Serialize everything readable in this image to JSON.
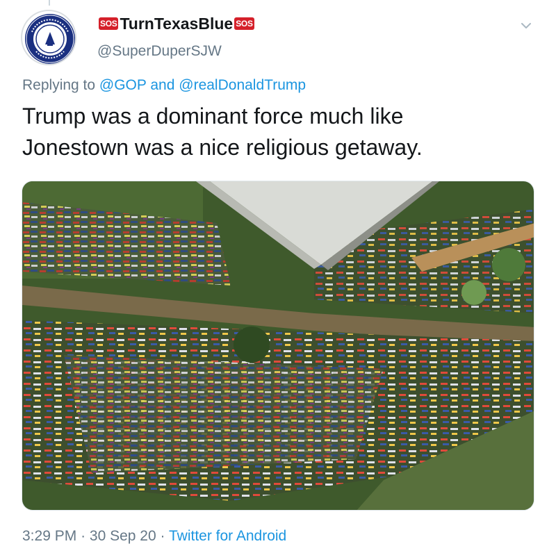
{
  "tweet": {
    "display_name": "TurnTexasBlue",
    "badge_left": "SOS",
    "badge_right": "SOS",
    "handle": "@SuperDuperSJW",
    "reply_prefix": "Replying to",
    "reply_mention_1": "@GOP",
    "reply_and": "and",
    "reply_mention_2": "@realDonaldTrump",
    "text_line_1": "Trump was a dominant force much like",
    "text_line_2": "Jonestown was a nice religious getaway.",
    "time": "3:29 PM",
    "separator": "·",
    "date": "30 Sep 20",
    "source": "Twitter for Android"
  },
  "colors": {
    "link": "#1b95e0",
    "secondary_text": "#657786",
    "badge_red": "#d5202a",
    "avatar_blue": "#1a2f80"
  },
  "icons": {
    "menu": "chevron-down-icon",
    "avatar": "union-seal-logo"
  }
}
